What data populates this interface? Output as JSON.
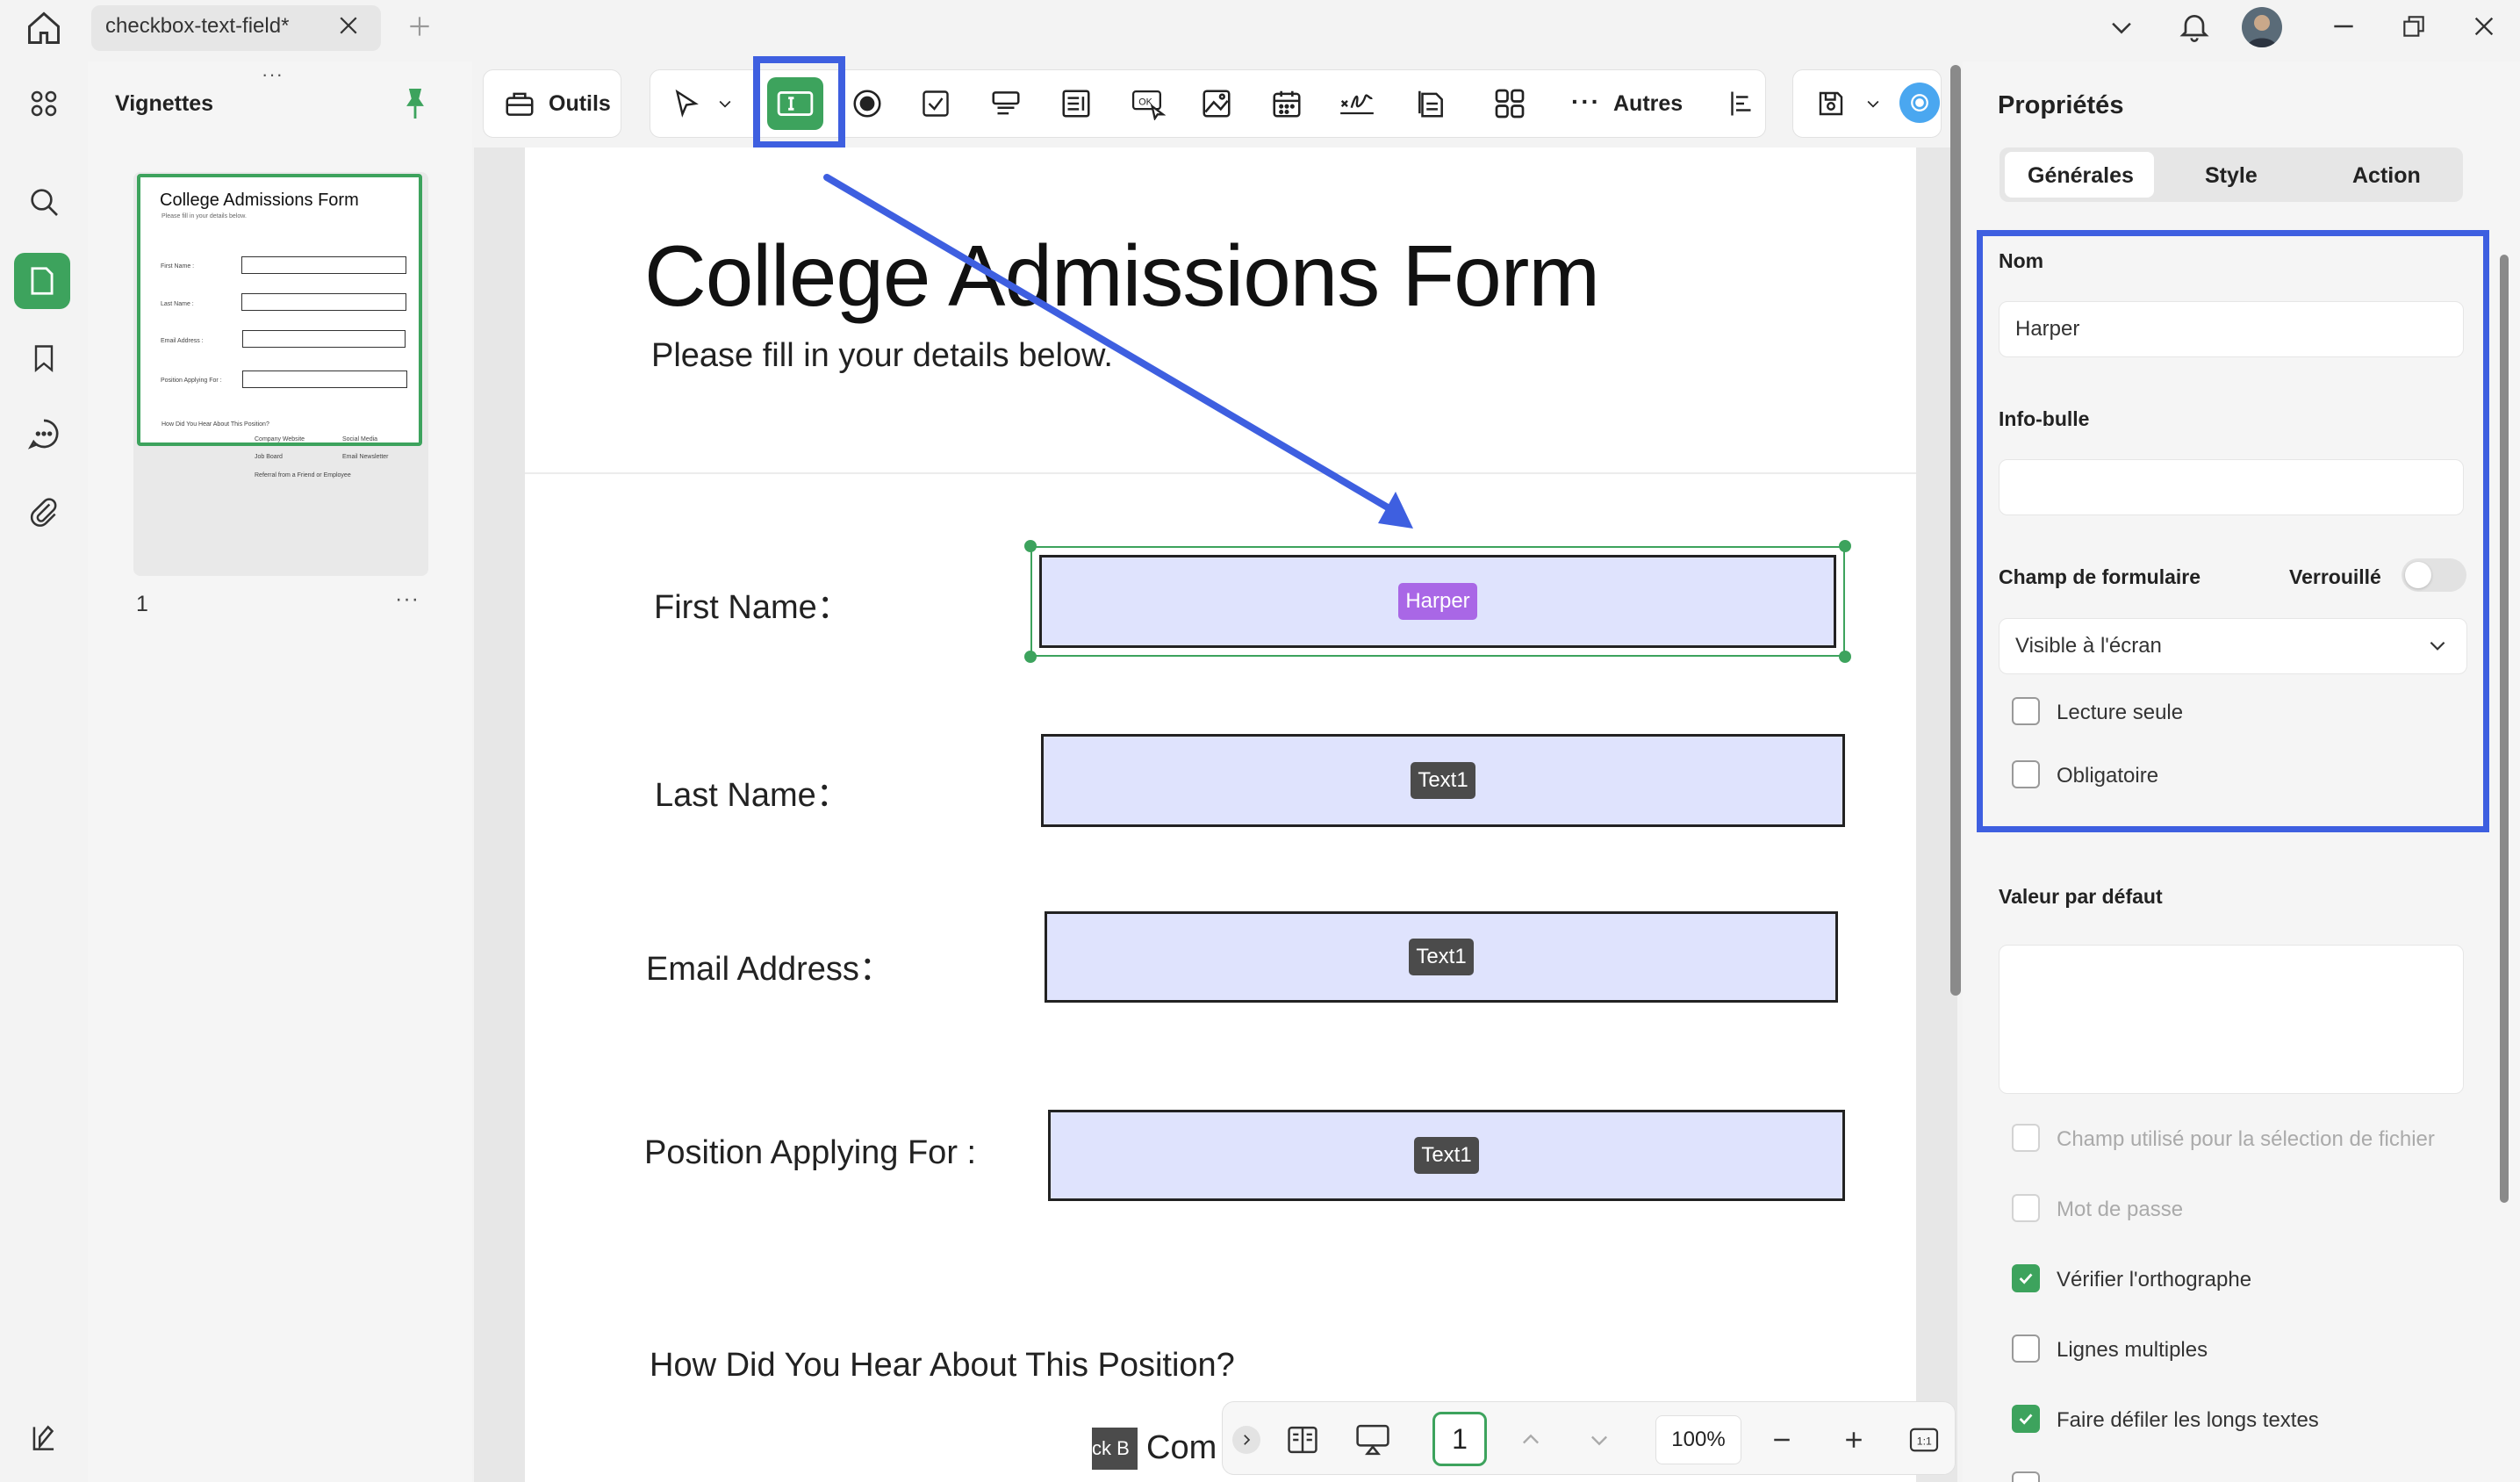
{
  "tab": {
    "title": "checkbox-text-field*"
  },
  "thumbnails": {
    "title": "Vignettes",
    "page_number": "1",
    "more": "···",
    "mini": {
      "title": "College Admissions Form",
      "subtitle": "Please fill in your details below.",
      "labels": [
        "First Name :",
        "Last Name :",
        "Email Address :",
        "Position Applying For :"
      ],
      "question": "How Did You Hear About This Position?",
      "options": [
        "Company Website",
        "Social Media",
        "Job Board",
        "Email Newsletter",
        "Referral from a Friend or Employee"
      ]
    }
  },
  "toolbar": {
    "tools_label": "Outils",
    "others_label": "Autres"
  },
  "document": {
    "title": "College Admissions Form",
    "subtitle": "Please fill in your details below.",
    "fields": [
      {
        "label": "First Name：",
        "tag": "Harper"
      },
      {
        "label": "Last Name：",
        "tag": "Text1"
      },
      {
        "label": "Email Address：",
        "tag": "Text1"
      },
      {
        "label": "Position Applying For :",
        "tag": "Text1"
      }
    ],
    "question": "How Did You Hear About This Position?",
    "partial_option_text": "Com",
    "partial_tag": "ck B"
  },
  "bottom_bar": {
    "page": "1",
    "zoom": "100%"
  },
  "properties": {
    "title": "Propriétés",
    "tabs": [
      "Générales",
      "Style",
      "Action"
    ],
    "name_label": "Nom",
    "name_value": "Harper",
    "tooltip_label": "Info-bulle",
    "tooltip_value": "",
    "form_field_label": "Champ de formulaire",
    "locked_label": "Verrouillé",
    "visibility_value": "Visible à l'écran",
    "read_only_label": "Lecture seule",
    "required_label": "Obligatoire",
    "default_value_label": "Valeur par défaut",
    "default_value": "",
    "file_select_label": "Champ utilisé pour la sélection de fichier",
    "password_label": "Mot de passe",
    "spellcheck_label": "Vérifier l'orthographe",
    "multiline_label": "Lignes multiples",
    "scroll_label": "Faire défiler les longs textes"
  },
  "colors": {
    "accent_green": "#3da35d",
    "highlight_blue": "#3e5fe0",
    "field_fill": "#dfe3fd",
    "selected_tag": "#a967e6"
  }
}
